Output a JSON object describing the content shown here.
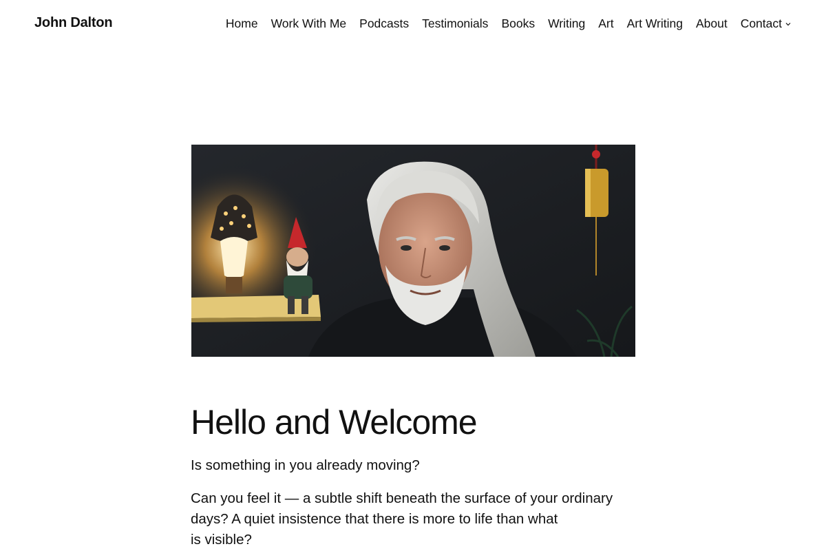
{
  "header": {
    "site_title": "John Dalton",
    "nav": [
      {
        "label": "Home"
      },
      {
        "label": "Work With Me"
      },
      {
        "label": "Podcasts"
      },
      {
        "label": "Testimonials"
      },
      {
        "label": "Books"
      },
      {
        "label": "Writing"
      },
      {
        "label": "Art"
      },
      {
        "label": "Art Writing"
      },
      {
        "label": "About"
      },
      {
        "label": "Contact",
        "has_submenu": true
      }
    ]
  },
  "hero": {
    "image_description": "Portrait of a smiling man with long white hair and a white beard in a dark room, a glowing lantern and a gnome figurine on a shelf to the left, a brass bell hanging on the right",
    "colors": {
      "wall": "#1f2226",
      "lamp_glow": "#ffb347",
      "shelf": "#e3c877",
      "bell": "#c99a2c",
      "gnome_hat": "#c6282c"
    }
  },
  "main": {
    "heading": "Hello and Welcome",
    "tagline": "Is something in you already moving?",
    "intro_line1": "Can you feel it — a subtle shift beneath the surface of your ordinary",
    "intro_line2": "days? A quiet insistence that there is more to life than what",
    "intro_line3": "is visible?"
  }
}
